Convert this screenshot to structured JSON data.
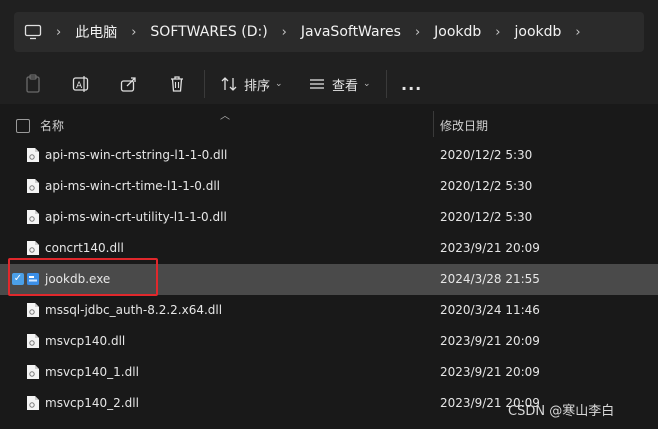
{
  "breadcrumb": {
    "items": [
      "此电脑",
      "SOFTWARES (D:)",
      "JavaSoftWares",
      "Jookdb",
      "jookdb"
    ]
  },
  "toolbar": {
    "sort_label": "排序",
    "view_label": "查看",
    "more_label": "..."
  },
  "columns": {
    "name": "名称",
    "date": "修改日期"
  },
  "files": [
    {
      "name": "api-ms-win-crt-string-l1-1-0.dll",
      "date": "2020/12/2 5:30",
      "icon": "file-dll-icon",
      "selected": false
    },
    {
      "name": "api-ms-win-crt-time-l1-1-0.dll",
      "date": "2020/12/2 5:30",
      "icon": "file-dll-icon",
      "selected": false
    },
    {
      "name": "api-ms-win-crt-utility-l1-1-0.dll",
      "date": "2020/12/2 5:30",
      "icon": "file-dll-icon",
      "selected": false
    },
    {
      "name": "concrt140.dll",
      "date": "2023/9/21 20:09",
      "icon": "file-dll-icon",
      "selected": false
    },
    {
      "name": "jookdb.exe",
      "date": "2024/3/28 21:55",
      "icon": "app-exe-icon",
      "selected": true
    },
    {
      "name": "mssql-jdbc_auth-8.2.2.x64.dll",
      "date": "2020/3/24 11:46",
      "icon": "file-dll-icon",
      "selected": false
    },
    {
      "name": "msvcp140.dll",
      "date": "2023/9/21 20:09",
      "icon": "file-dll-icon",
      "selected": false
    },
    {
      "name": "msvcp140_1.dll",
      "date": "2023/9/21 20:09",
      "icon": "file-dll-icon",
      "selected": false
    },
    {
      "name": "msvcp140_2.dll",
      "date": "2023/9/21 20:09",
      "icon": "file-dll-icon",
      "selected": false
    }
  ],
  "watermark": "CSDN @寒山李白",
  "colors": {
    "background": "#191919",
    "selected_row": "#4a4a4a",
    "highlight_box": "#e0282c",
    "checkbox_accent": "#4ba0e8"
  }
}
